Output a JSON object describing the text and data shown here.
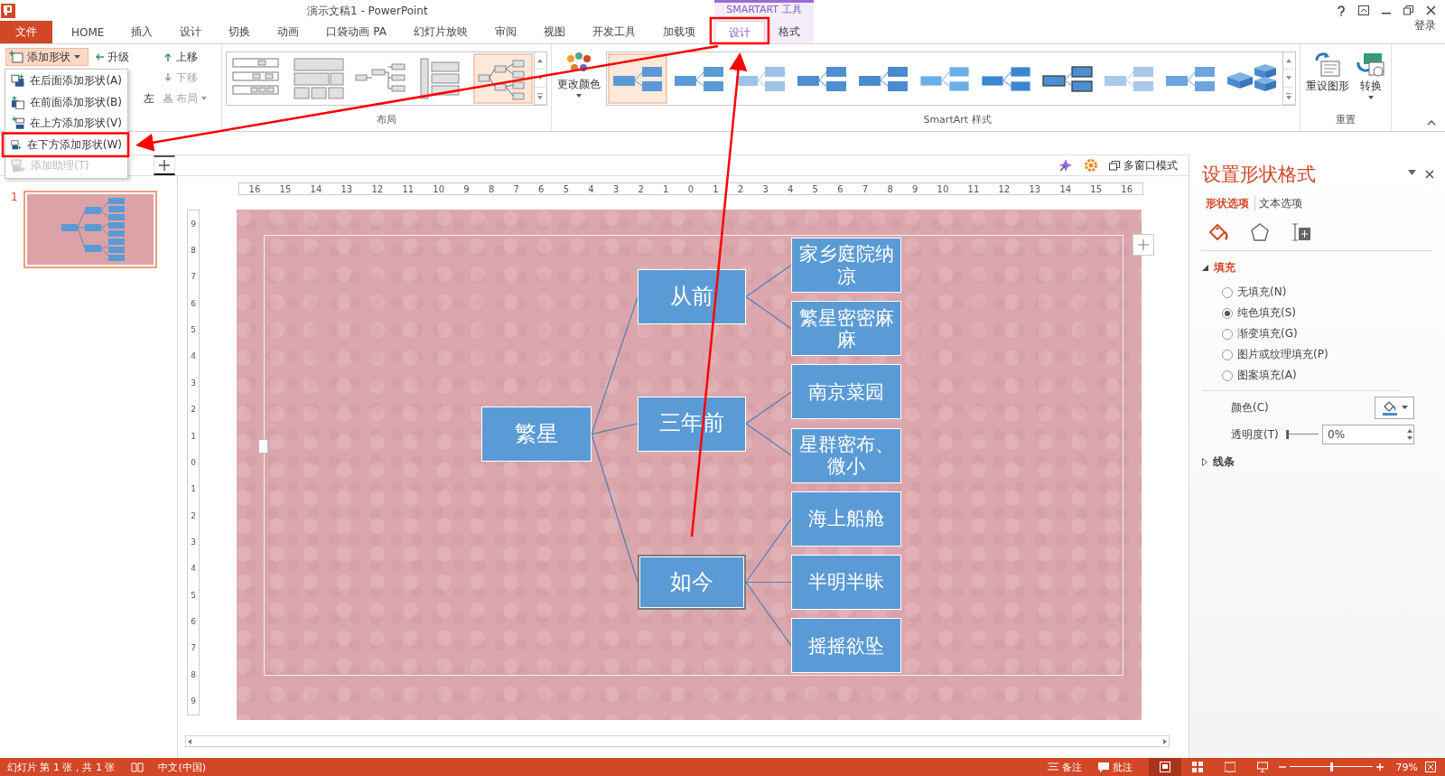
{
  "window": {
    "title": "演示文稿1 - PowerPoint",
    "context_group": "SMARTART 工具",
    "account": "登录"
  },
  "tabs": [
    {
      "label": "文件",
      "kind": "file",
      "selected": false
    },
    {
      "label": "HOME",
      "kind": "main",
      "selected": false
    },
    {
      "label": "插入",
      "kind": "main",
      "selected": false
    },
    {
      "label": "设计",
      "kind": "main",
      "selected": false
    },
    {
      "label": "切换",
      "kind": "main",
      "selected": false
    },
    {
      "label": "动画",
      "kind": "main",
      "selected": false
    },
    {
      "label": "口袋动画 PA",
      "kind": "main",
      "selected": false
    },
    {
      "label": "幻灯片放映",
      "kind": "main",
      "selected": false
    },
    {
      "label": "审阅",
      "kind": "main",
      "selected": false
    },
    {
      "label": "视图",
      "kind": "main",
      "selected": false
    },
    {
      "label": "开发工具",
      "kind": "main",
      "selected": false
    },
    {
      "label": "加载项",
      "kind": "main",
      "selected": false
    },
    {
      "label": "设计",
      "kind": "context",
      "selected": true
    },
    {
      "label": "格式",
      "kind": "context",
      "selected": false
    }
  ],
  "ribbon": {
    "create": {
      "add_shape": "添加形状",
      "commands": [
        {
          "label": "升级",
          "kind": "promote",
          "disabled": false
        },
        {
          "label": "上移",
          "kind": "up",
          "disabled": false
        },
        {
          "label": "下移",
          "kind": "down",
          "disabled": true
        },
        {
          "label": "左",
          "kind": "rtl",
          "disabled": false
        },
        {
          "label": "布局",
          "kind": "layout",
          "disabled": true
        }
      ]
    },
    "layouts": {
      "label": "布局",
      "items": [
        {
          "selected": false
        },
        {
          "selected": false
        },
        {
          "selected": false
        },
        {
          "selected": false
        },
        {
          "selected": true
        }
      ]
    },
    "change_colors": "更改颜色",
    "styles": {
      "label": "SmartArt 样式",
      "items": [
        {
          "selected": true
        },
        {
          "selected": false
        },
        {
          "selected": false
        },
        {
          "selected": false
        },
        {
          "selected": false
        },
        {
          "selected": false
        },
        {
          "selected": false
        },
        {
          "selected": false
        },
        {
          "selected": false
        },
        {
          "selected": false
        },
        {
          "selected": false
        }
      ]
    },
    "reset": {
      "label": "重置",
      "buttons": [
        {
          "label": "重设图形",
          "kind": "reset"
        },
        {
          "label": "转换",
          "kind": "convert"
        }
      ]
    }
  },
  "add_shape_menu": [
    {
      "label": "在后面添加形状(A)",
      "kind": "after",
      "disabled": false
    },
    {
      "label": "在前面添加形状(B)",
      "kind": "before",
      "disabled": false
    },
    {
      "label": "在上方添加形状(V)",
      "kind": "above",
      "disabled": false
    },
    {
      "label": "在下方添加形状(W)",
      "kind": "below",
      "disabled": false
    },
    {
      "label": "添加助理(T)",
      "kind": "assistant",
      "disabled": true
    }
  ],
  "slides_pane": {
    "slides": [
      {
        "number": "1",
        "selected": true
      }
    ]
  },
  "editor_toolbar": {
    "multi_window": "多窗口模式"
  },
  "rulers": {
    "horizontal": [
      "16",
      "15",
      "14",
      "13",
      "12",
      "11",
      "10",
      "9",
      "8",
      "7",
      "6",
      "5",
      "4",
      "3",
      "2",
      "1",
      "0",
      "1",
      "2",
      "3",
      "4",
      "5",
      "6",
      "7",
      "8",
      "9",
      "10",
      "11",
      "12",
      "13",
      "14",
      "15",
      "16"
    ],
    "vertical": [
      "9",
      "8",
      "7",
      "6",
      "5",
      "4",
      "3",
      "2",
      "1",
      "0",
      "1",
      "2",
      "3",
      "4",
      "5",
      "6",
      "7",
      "8",
      "9"
    ]
  },
  "smartart": {
    "root": {
      "label": "繁星",
      "selected": false,
      "children": [
        {
          "label": "从前",
          "selected": false,
          "children": [
            {
              "label": "家乡庭院纳凉",
              "selected": false
            },
            {
              "label": "繁星密密麻麻",
              "selected": false
            }
          ]
        },
        {
          "label": "三年前",
          "selected": false,
          "children": [
            {
              "label": "南京菜园",
              "selected": false
            },
            {
              "label": "星群密布、微小",
              "selected": false
            }
          ]
        },
        {
          "label": "如今",
          "selected": true,
          "children": [
            {
              "label": "海上船舱",
              "selected": false
            },
            {
              "label": "半明半昧",
              "selected": false
            },
            {
              "label": "摇摇欲坠",
              "selected": false
            }
          ]
        }
      ]
    }
  },
  "format_pane": {
    "title": "设置形状格式",
    "tabs": [
      {
        "label": "形状选项",
        "selected": true
      },
      {
        "label": "文本选项",
        "selected": false
      }
    ],
    "icon_tabs": [
      {
        "kind": "fill",
        "selected": true
      },
      {
        "kind": "effects",
        "selected": false
      },
      {
        "kind": "size",
        "selected": false
      }
    ],
    "sections": [
      {
        "label": "填充",
        "expanded": true,
        "options": [
          {
            "label": "无填充(N)",
            "selected": false
          },
          {
            "label": "纯色填充(S)",
            "selected": true
          },
          {
            "label": "渐变填充(G)",
            "selected": false
          },
          {
            "label": "图片或纹理填充(P)",
            "selected": false
          },
          {
            "label": "图案填充(A)",
            "selected": false
          }
        ],
        "color_label": "颜色(C)",
        "transparency_label": "透明度(T)",
        "transparency": {
          "level": 0,
          "value": "0%"
        }
      },
      {
        "label": "线条",
        "expanded": false
      }
    ]
  },
  "status_bar": {
    "slide_info": "幻灯片 第 1 张，共 1 张",
    "language": "中文(中国)",
    "notes": "备注",
    "comments": "批注",
    "views": [
      {
        "kind": "normal",
        "selected": true
      },
      {
        "kind": "sorter",
        "selected": false
      },
      {
        "kind": "reading",
        "selected": false
      },
      {
        "kind": "show",
        "selected": false
      }
    ],
    "zoom": {
      "level": 0.5,
      "value": "79%"
    }
  }
}
